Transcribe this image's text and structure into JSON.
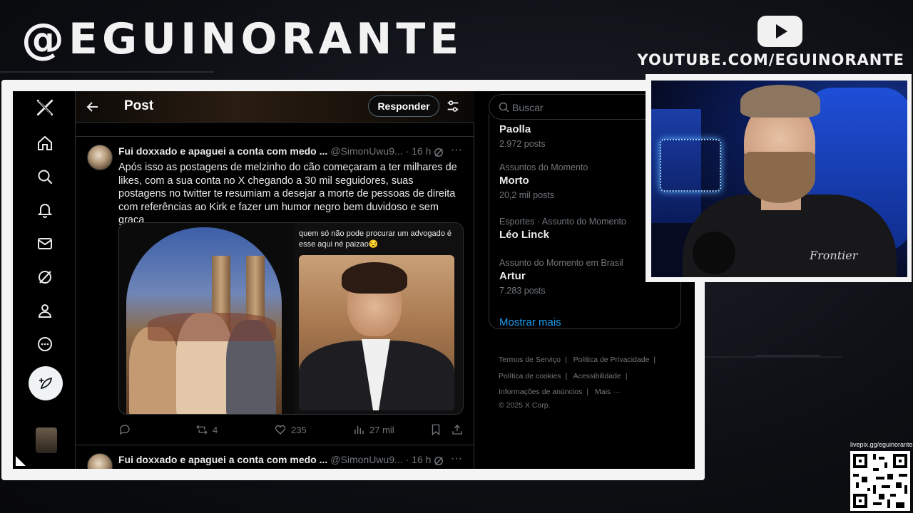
{
  "overlay": {
    "brand": "@EGUINORANTE",
    "youtube_url": "YOUTUBE.COM/EGUINORANTE",
    "qr_label": "livepix.gg/eguinorante"
  },
  "x_app": {
    "topbar": {
      "title": "Post",
      "reply_button": "Responder"
    },
    "tweets": [
      {
        "name": "Fui doxxado e apaguei a conta com medo ...",
        "handle": "@SimonUwu9...",
        "time": "· 16 h",
        "body": "Após isso as postagens de melzinho do cão começaram a ter milhares de likes, com a sua conta no X chegando a 30 mil seguidores, suas postagens no twitter te resumiam a desejar a morte de pessoas de direita com referências ao Kirk e fazer um humor negro bem duvidoso e sem graça",
        "meme_caption": "quem só não pode procurar um advogado é esse aqui né paizao😒",
        "replies": "",
        "reposts": "4",
        "likes": "235",
        "views": "27 mil"
      },
      {
        "name": "Fui doxxado e apaguei a conta com medo ...",
        "handle": "@SimonUwu9...",
        "time": "· 16 h"
      }
    ],
    "search": {
      "placeholder": "Buscar"
    },
    "trends": [
      {
        "meta": "",
        "name": "Paolla",
        "count": "2.972 posts"
      },
      {
        "meta": "Assuntos do Momento",
        "name": "Morto",
        "count": "20,2 mil posts"
      },
      {
        "meta": "Esportes · Assunto do Momento",
        "name": "Léo Linck",
        "count": ""
      },
      {
        "meta": "Assunto do Momento em Brasil",
        "name": "Artur",
        "count": "7.283 posts"
      }
    ],
    "show_more": "Mostrar mais",
    "footer": {
      "terms": "Termos de Serviço",
      "privacy": "Política de Privacidade",
      "cookies": "Política de cookies",
      "accessibility": "Acessibilidade",
      "ads_info": "Informações de anúncios",
      "more": "Mais ···",
      "copyright": "© 2025 X Corp."
    }
  },
  "webcam": {
    "shirt_text": "Frontier"
  },
  "colors": {
    "accent_blue": "#1d9bf0",
    "x_background": "#000000",
    "border": "#2f3336",
    "muted_text": "#71767b"
  },
  "icons": [
    "x-logo-icon",
    "home-icon",
    "explore-icon",
    "notifications-icon",
    "messages-icon",
    "grok-icon",
    "profile-icon",
    "more-circle-icon",
    "compose-icon",
    "back-arrow-icon",
    "tune-icon",
    "search-icon",
    "reply-icon",
    "repost-icon",
    "like-icon",
    "views-icon",
    "bookmark-icon",
    "share-icon",
    "youtube-icon"
  ]
}
